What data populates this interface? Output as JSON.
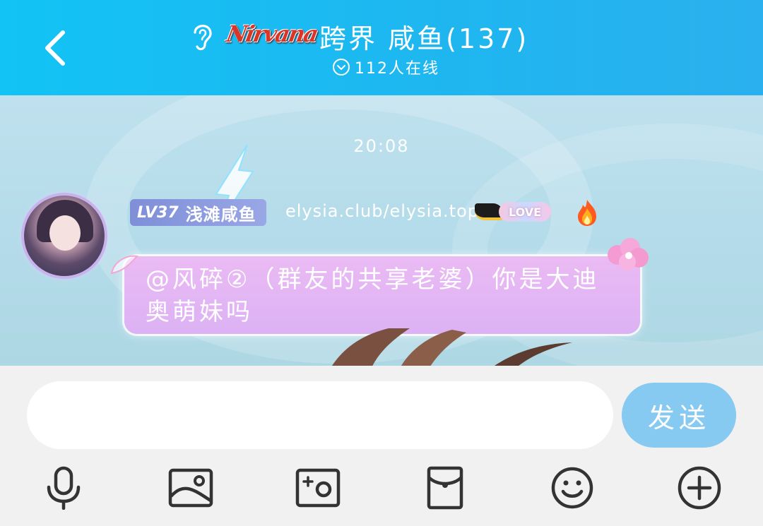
{
  "header": {
    "back_icon": "chevron-left-icon",
    "listen_icon": "ear-icon",
    "logo_text": "Nirvana",
    "title": "跨界 咸鱼(137)",
    "online_icon": "chevron-down-circle-icon",
    "online_text": "112人在线",
    "background": "#1fb6f0"
  },
  "chat": {
    "timestamp": "20:08",
    "messages": [
      {
        "avatar_icon": "avatar",
        "level": "LV37",
        "nickname": "浅滩咸鱼",
        "title": "elysia.club/elysia.top",
        "badge": "LOVE",
        "fire_icon": "fire-icon",
        "text": "@风碎②（群友的共享老婆）你是大迪奥萌妹吗"
      }
    ]
  },
  "input": {
    "value": "",
    "placeholder": "",
    "send_label": "发送",
    "send_color": "#86c9f1"
  },
  "toolbar": {
    "items": [
      {
        "icon": "microphone-icon"
      },
      {
        "icon": "image-icon"
      },
      {
        "icon": "camera-icon"
      },
      {
        "icon": "red-packet-icon"
      },
      {
        "icon": "emoji-icon"
      },
      {
        "icon": "plus-circle-icon"
      }
    ]
  }
}
